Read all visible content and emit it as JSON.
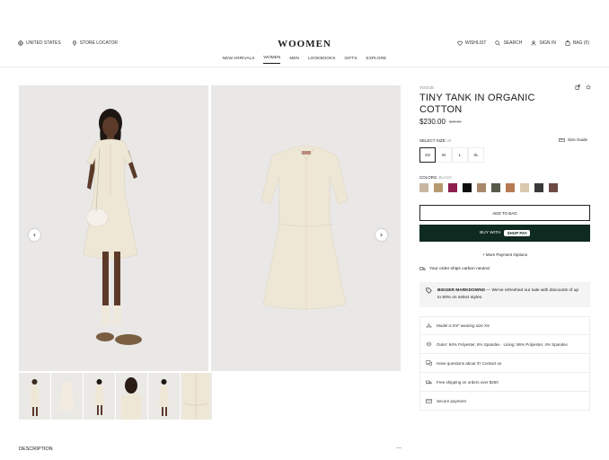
{
  "header": {
    "left": [
      {
        "icon": "globe-icon",
        "label": "UNITED STATES"
      },
      {
        "icon": "pin-icon",
        "label": "STORE LOCATOR"
      }
    ],
    "logo": "WOOMEN",
    "right": [
      {
        "icon": "heart-icon",
        "label": "WISHLIST"
      },
      {
        "icon": "search-icon",
        "label": "SEARCH"
      },
      {
        "icon": "user-icon",
        "label": "SIGN IN"
      },
      {
        "icon": "bag-icon",
        "label": "BAG (0)"
      }
    ],
    "nav": [
      "NEW ARRIVALS",
      "WOMEN",
      "MEN",
      "LOOKBOOKS",
      "GIFTS",
      "EXPLORE"
    ],
    "active_nav": "WOMEN"
  },
  "product": {
    "brand": "VOGUE",
    "title": "TINY TANK IN ORGANIC COTTON",
    "price": "$230.00",
    "old_price": "$69.95",
    "size_label": "SELECT SIZE:",
    "size_value": "M",
    "size_guide": "Size Guide",
    "sizes": [
      "XS",
      "M",
      "L",
      "XL"
    ],
    "selected_size": "XS",
    "colors_label": "COLORS:",
    "color_value": "BLACK",
    "swatches": [
      "#c9b6a0",
      "#b89a70",
      "#8e1e4e",
      "#0e0e0e",
      "#a8886a",
      "#5a5a4a",
      "#b87a55",
      "#d9c9ae",
      "#3a3a3a",
      "#6e4a44"
    ],
    "add_to_bag": "ADD TO BAG",
    "buy_with": "BUY WITH",
    "shop_pay": "shop Pay",
    "more_payment": "+ More Payment Options",
    "carbon": "Your order ships carbon neutral",
    "markdown_title": "BIGGER MARKDOWNS",
    "markdown_text": "— We've refreshed our sale with discounts of up to 50% on select styles.",
    "info": [
      {
        "icon": "hanger-icon",
        "text": "Model is 5'8\" wearing size XS"
      },
      {
        "icon": "fabric-icon",
        "text": "Outer: 94% Polyester, 6% Spandex  ·  Lining: 96% Polyester, 4% Spandex"
      },
      {
        "icon": "chat-icon",
        "text": "Have questions about it? Contact us"
      },
      {
        "icon": "truck-icon",
        "text": "Free shipping on orders over $250"
      },
      {
        "icon": "card-icon",
        "text": "Secure payment"
      }
    ]
  },
  "description_label": "DESCRIPTION",
  "description_toggle": "—",
  "colors": {
    "accent": "#0f2a21",
    "dress": "#efe7d6",
    "gallery_bg": "#e9e8e6"
  }
}
